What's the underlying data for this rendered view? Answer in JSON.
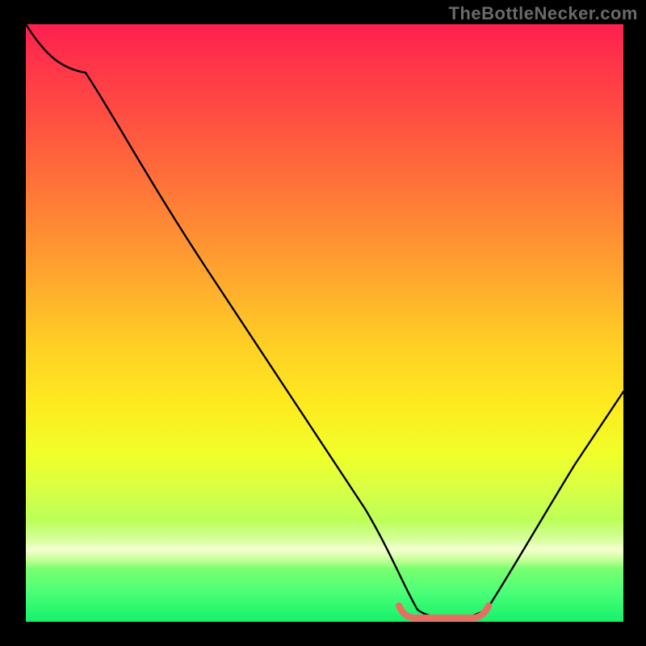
{
  "watermark": "TheBottleNecker.com",
  "chart_data": {
    "type": "line",
    "title": "",
    "xlabel": "",
    "ylabel": "",
    "xlim": [
      0,
      100
    ],
    "ylim": [
      0,
      100
    ],
    "series": [
      {
        "name": "bottleneck-curve",
        "x": [
          0,
          5,
          10,
          20,
          30,
          40,
          50,
          58,
          63,
          68,
          74,
          80,
          88,
          100
        ],
        "values": [
          100,
          96,
          92,
          79,
          64,
          48,
          32,
          18,
          6,
          2,
          2,
          5,
          15,
          35
        ]
      }
    ],
    "annotations": [
      {
        "name": "optimal-range-marker",
        "x_start": 62,
        "x_end": 76,
        "y": 1,
        "color": "#e86d63"
      }
    ],
    "background_gradient_top": "#ff1f4f",
    "background_gradient_bottom": "#16f06a"
  }
}
